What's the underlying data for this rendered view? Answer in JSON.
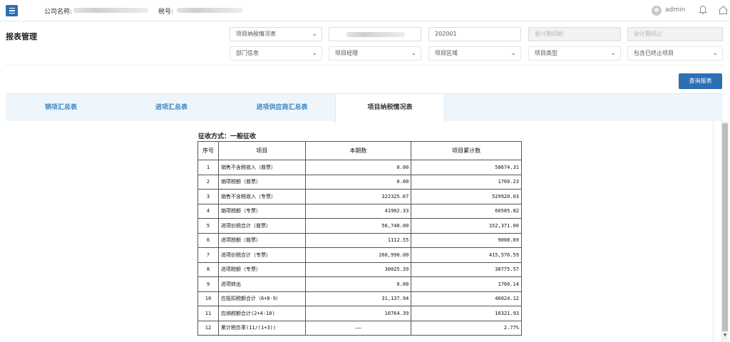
{
  "header": {
    "company_label": "公司名称:",
    "tax_label": "税号:",
    "user": "admin",
    "accent": "#2e6fb3"
  },
  "filters": {
    "title": "报表管理",
    "report_type": "项目纳税情况表",
    "period": "202001",
    "start_placeholder": "会计期间始",
    "end_placeholder": "会计期间止",
    "dept": "部门信息",
    "manager": "项目经理",
    "region": "项目区域",
    "category": "项目类型",
    "include_stopped": "包含已终止项目",
    "query_button": "查询报表"
  },
  "tabs": [
    "销项汇总表",
    "进项汇总表",
    "进项供应商汇总表",
    "项目纳税情况表"
  ],
  "report": {
    "levy": "征收方式：一般征收",
    "headers": [
      "序号",
      "项目",
      "本期数",
      "项目累计数"
    ],
    "rows": [
      {
        "no": "1",
        "item": "销售不含税收入（普票）",
        "current": "0.00",
        "total": "58674.31"
      },
      {
        "no": "2",
        "item": "销项税额（普票）",
        "current": "0.00",
        "total": "1760.23"
      },
      {
        "no": "3",
        "item": "销售不含税收入（专票）",
        "current": "322325.67",
        "total": "529920.03"
      },
      {
        "no": "4",
        "item": "销项税额（专票）",
        "current": "41902.33",
        "total": "60585.82"
      },
      {
        "no": "5",
        "item": "进项价税合计（普票）",
        "current": "56,740.00",
        "total": "152,371.00"
      },
      {
        "no": "6",
        "item": "进项税额（普票）",
        "current": "1112.55",
        "total": "9008.69"
      },
      {
        "no": "7",
        "item": "进项价税合计（专票）",
        "current": "260,990.00",
        "total": "415,576.59"
      },
      {
        "no": "8",
        "item": "进项税额（专票）",
        "current": "30025.39",
        "total": "30775.57"
      },
      {
        "no": "9",
        "item": "进项转出",
        "current": "0.00",
        "total": "1760.14"
      },
      {
        "no": "10",
        "item": "应抵扣税额合计（6+8-9）",
        "current": "31,137.94",
        "total": "46024.12"
      },
      {
        "no": "11",
        "item": "应纳税额合计(2+4-10)",
        "current": "10764.39",
        "total": "16321.93"
      },
      {
        "no": "12",
        "item": "累计税负率(11/(1+3))",
        "current": "——",
        "total": "2.77%"
      }
    ]
  },
  "icons": {
    "menu": "menu-icon",
    "bell": "bell-icon",
    "home": "home-icon",
    "avatar": "avatar-icon"
  }
}
